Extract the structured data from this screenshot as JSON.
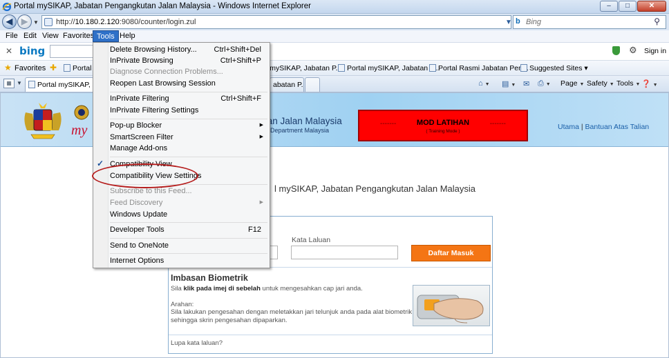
{
  "window": {
    "title": "Portal mySIKAP, Jabatan Pengangkutan Jalan Malaysia - Windows Internet Explorer",
    "minimize": "–",
    "maximize": "□",
    "close": "✕"
  },
  "address": {
    "url_prefix": "http://",
    "url_host": "10.180.2.120",
    "url_rest": ":9080/counter/login.zul",
    "search_placeholder": "Bing",
    "search_brand": "b"
  },
  "menubar": {
    "items": [
      "File",
      "Edit",
      "View",
      "Favorites",
      "Tools",
      "Help"
    ],
    "active": "Tools"
  },
  "bingbar": {
    "logo": "bing",
    "signin": "Sign in"
  },
  "favorites": {
    "label": "Favorites",
    "items": [
      "Portal",
      "l mySIKAP, Jabatan P...",
      "Portal mySIKAP, Jabatan P...",
      "Portal Rasmi Jabatan Pen...",
      "Suggested Sites ▾"
    ]
  },
  "tabs": {
    "active": "Portal mySIKAP, Jab",
    "inactive": "abatan P..."
  },
  "commandbar": {
    "page": "Page",
    "safety": "Safety",
    "tools": "Tools"
  },
  "tools_menu": {
    "items": [
      {
        "label": "Delete Browsing History...",
        "shortcut": "Ctrl+Shift+Del"
      },
      {
        "label": "InPrivate Browsing",
        "shortcut": "Ctrl+Shift+P"
      },
      {
        "label": "Diagnose Connection Problems...",
        "disabled": true
      },
      {
        "label": "Reopen Last Browsing Session"
      },
      {
        "label": "InPrivate Filtering",
        "shortcut": "Ctrl+Shift+F"
      },
      {
        "label": "InPrivate Filtering Settings"
      },
      {
        "label": "Pop-up Blocker",
        "submenu": true
      },
      {
        "label": "SmartScreen Filter",
        "submenu": true
      },
      {
        "label": "Manage Add-ons"
      },
      {
        "label": "Compatibility View",
        "checked": true
      },
      {
        "label": "Compatibility View Settings",
        "highlighted": true
      },
      {
        "label": "Subscribe to this Feed...",
        "disabled": true
      },
      {
        "label": "Feed Discovery",
        "disabled": true,
        "submenu": true
      },
      {
        "label": "Windows Update"
      },
      {
        "label": "Developer Tools",
        "shortcut": "F12"
      },
      {
        "label": "Send to OneNote"
      },
      {
        "label": "Internet Options"
      }
    ]
  },
  "site": {
    "org_name": "tan Jalan Malaysia",
    "org_sub": "rt Department Malaysia",
    "mod_title": "MOD LATIHAN",
    "mod_sub": "( Training Mode )",
    "mod_dashes": "-------",
    "link_home": "Utama",
    "link_sep": "|",
    "link_help": "Bantuan Atas Talian",
    "welcome": "l mySIKAP, Jabatan Pengangkutan Jalan Malaysia"
  },
  "login": {
    "password_label": "Kata Laluan",
    "login_button": "Daftar Masuk",
    "bio_title": "Imbasan Biometrik",
    "bio_instr_pre": "Sila ",
    "bio_instr_bold": "klik pada imej di sebelah",
    "bio_instr_post": " untuk mengesahkan cap jari anda.",
    "arahan_label": "Arahan:",
    "arahan_text": "Sila lakukan pengesahan dengan meletakkan jari telunjuk anda pada alat biometrik sehingga skrin pengesahan dipaparkan.",
    "forgot": "Lupa kata laluan?"
  },
  "colors": {
    "menu_active": "#2f71c8",
    "mod_box": "#ff0000",
    "login_button": "#f47514",
    "highlight_ring": "#b51c1c"
  }
}
